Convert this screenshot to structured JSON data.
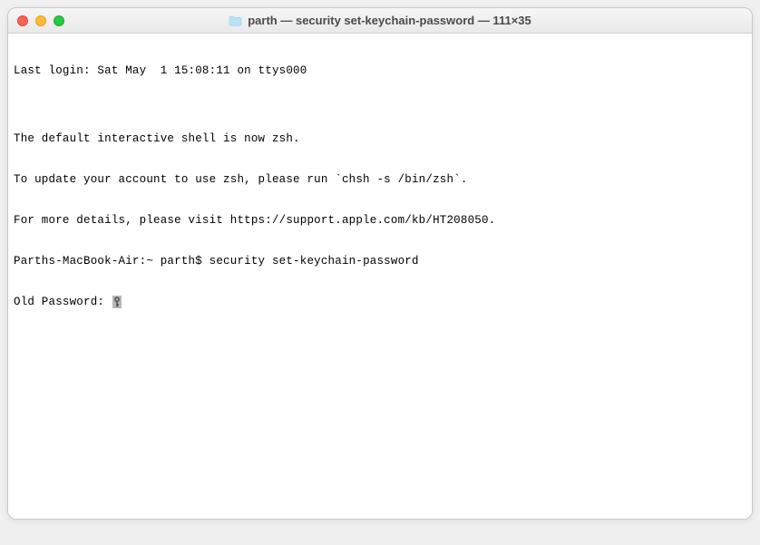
{
  "window": {
    "title": "parth — security set-keychain-password — 111×35"
  },
  "terminal": {
    "last_login": "Last login: Sat May  1 15:08:11 on ttys000",
    "blank": "",
    "msg1": "The default interactive shell is now zsh.",
    "msg2": "To update your account to use zsh, please run `chsh -s /bin/zsh`.",
    "msg3": "For more details, please visit https://support.apple.com/kb/HT208050.",
    "prompt": "Parths-MacBook-Air:~ parth$ ",
    "command": "security set-keychain-password",
    "password_prompt": "Old Password: "
  }
}
